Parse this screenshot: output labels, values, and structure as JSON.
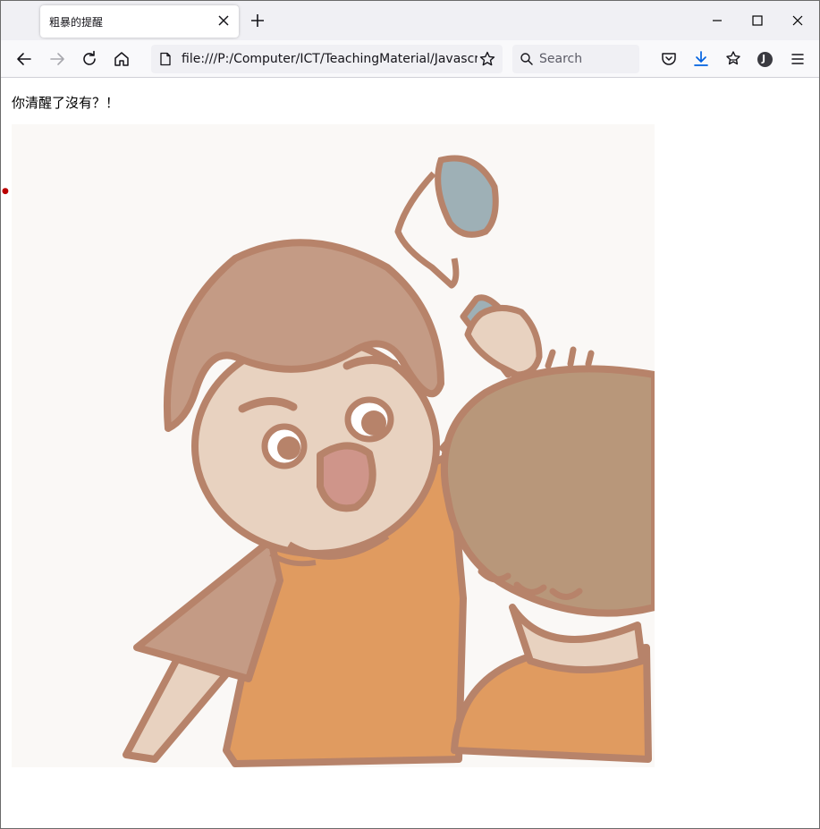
{
  "browser": {
    "tab": {
      "title": "粗暴的提醒"
    },
    "address": {
      "url": "file:///P:/Computer/ICT/TeachingMaterial/Javascript"
    },
    "search": {
      "placeholder": "Search"
    },
    "profile_initial": "J"
  },
  "page": {
    "heading": "你清醒了沒有？！"
  },
  "icons": {
    "back": "back-arrow-icon",
    "forward": "forward-arrow-icon",
    "reload": "reload-icon",
    "home": "home-icon",
    "page": "page-icon",
    "bookmark": "star-icon",
    "search": "search-icon",
    "pocket": "pocket-icon",
    "downloads": "download-icon",
    "extensions": "extensions-icon",
    "account": "account-icon",
    "menu": "hamburger-menu-icon"
  },
  "colors": {
    "accent_download": "#0061e0",
    "skin": "#e8d2c0",
    "outline": "#b7836a",
    "hair_left": "#c49b85",
    "hair_right": "#b8977a",
    "shirt": "#e09b60",
    "spoon": "#9eb0b6"
  }
}
